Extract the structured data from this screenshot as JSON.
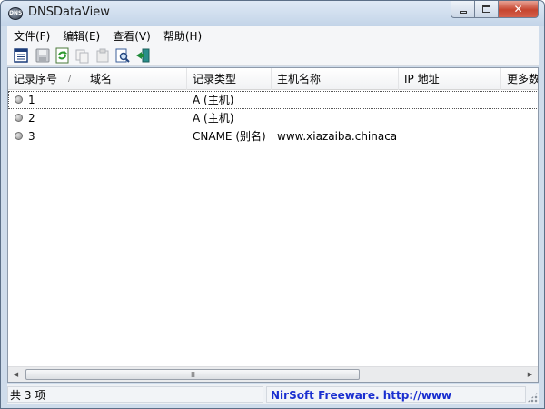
{
  "window": {
    "title": "DNSDataView",
    "app_icon_text": "DNS",
    "close_glyph": "✕"
  },
  "menu": [
    {
      "label": "文件(F)"
    },
    {
      "label": "编辑(E)"
    },
    {
      "label": "查看(V)"
    },
    {
      "label": "帮助(H)"
    }
  ],
  "toolbar": [
    {
      "icon": "properties-icon"
    },
    {
      "icon": "save-icon"
    },
    {
      "icon": "refresh-icon"
    },
    {
      "icon": "copy-icon"
    },
    {
      "icon": "html-report-icon"
    },
    {
      "icon": "find-icon"
    },
    {
      "icon": "exit-icon"
    }
  ],
  "table": {
    "columns": [
      "记录序号",
      "域名",
      "记录类型",
      "主机名称",
      "IP 地址",
      "更多数"
    ],
    "sort_glyph": "/",
    "rows": [
      {
        "num": "1",
        "domain": "",
        "type": "A (主机)",
        "host": "",
        "ip": "",
        "more": ""
      },
      {
        "num": "2",
        "domain": "",
        "type": "A (主机)",
        "host": "",
        "ip": "",
        "more": ""
      },
      {
        "num": "3",
        "domain": "",
        "type": "CNAME (别名)",
        "host": "www.xiazaiba.chinacac...",
        "ip": "",
        "more": ""
      }
    ]
  },
  "scrollbar": {
    "left_arrow": "◀",
    "right_arrow": "▶",
    "thumb_grip": "III"
  },
  "status": {
    "count": "共 3 项",
    "link": "NirSoft Freeware.  http://www"
  },
  "colors": {
    "link": "#1a2fd0",
    "close_button": "#c6452f",
    "title_gradient_top": "#dfe9f5"
  }
}
